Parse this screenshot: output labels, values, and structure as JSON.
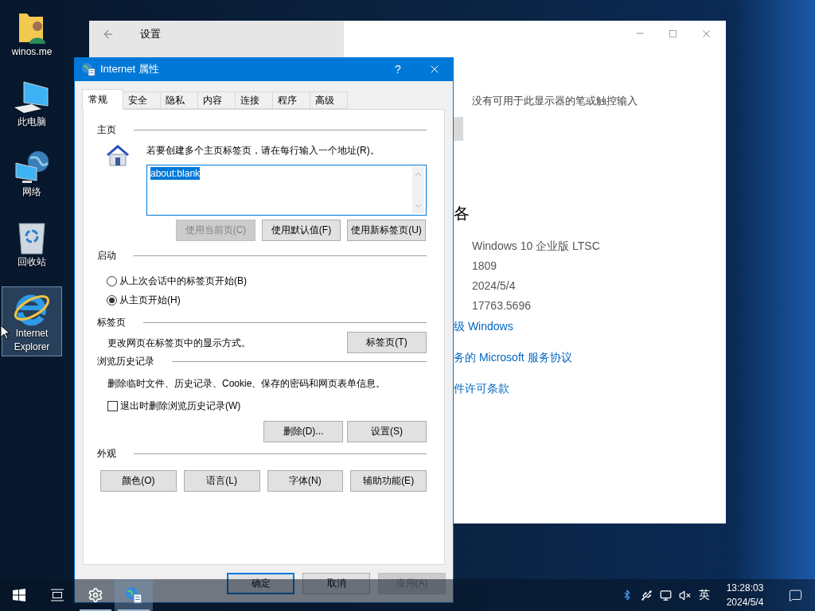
{
  "desktop_icons": [
    {
      "label": "winos.me",
      "kind": "user-folder",
      "selected": false
    },
    {
      "label": "此电脑",
      "kind": "computer",
      "selected": false
    },
    {
      "label": "网络",
      "kind": "network",
      "selected": false
    },
    {
      "label": "回收站",
      "kind": "recycle-bin",
      "selected": false
    },
    {
      "label": "Internet Explorer",
      "kind": "browser",
      "selected": true
    }
  ],
  "settings_window": {
    "title": "设置",
    "pen_notice": "没有可用于此显示器的笔或触控输入",
    "heading": "各",
    "specs": [
      "Windows 10 企业版 LTSC",
      "1809",
      "2024/5/4",
      "17763.5696"
    ],
    "links": [
      "级 Windows",
      "务的 Microsoft 服务协议",
      "件许可条款"
    ]
  },
  "dialog": {
    "title": "Internet 属性",
    "help": "?",
    "tabs": [
      {
        "label": "常规",
        "selected": true
      },
      {
        "label": "安全",
        "selected": false
      },
      {
        "label": "隐私",
        "selected": false
      },
      {
        "label": "内容",
        "selected": false
      },
      {
        "label": "连接",
        "selected": false
      },
      {
        "label": "程序",
        "selected": false
      },
      {
        "label": "高级",
        "selected": false
      }
    ],
    "home": {
      "heading": "主页",
      "hint": "若要创建多个主页标签页，请在每行输入一个地址(R)。",
      "value": "about:blank",
      "buttons": [
        {
          "label": "使用当前页(C)",
          "disabled": true
        },
        {
          "label": "使用默认值(F)",
          "disabled": false
        },
        {
          "label": "使用新标签页(U)",
          "disabled": false
        }
      ]
    },
    "startup": {
      "heading": "启动",
      "options": [
        {
          "label": "从上次会话中的标签页开始(B)",
          "selected": false
        },
        {
          "label": "从主页开始(H)",
          "selected": true
        }
      ]
    },
    "tab_settings": {
      "heading": "标签页",
      "description": "更改网页在标签页中的显示方式。",
      "button": "标签页(T)"
    },
    "history": {
      "heading": "浏览历史记录",
      "description": "删除临时文件、历史记录、Cookie、保存的密码和网页表单信息。",
      "checkbox": {
        "label": "退出时删除浏览历史记录(W)",
        "checked": false
      },
      "buttons": [
        "删除(D)...",
        "设置(S)"
      ]
    },
    "appearance": {
      "heading": "外观",
      "buttons": [
        "颜色(O)",
        "语言(L)",
        "字体(N)",
        "辅助功能(E)"
      ]
    },
    "buttons": [
      {
        "label": "确定",
        "default": true,
        "disabled": false
      },
      {
        "label": "取消",
        "default": false,
        "disabled": false
      },
      {
        "label": "应用(A)",
        "default": false,
        "disabled": true
      }
    ]
  },
  "taskbar": {
    "apps": [
      {
        "kind": "settings",
        "selected": false
      },
      {
        "kind": "internet-options",
        "selected": true
      }
    ],
    "ime": "英",
    "time": "13:28:03",
    "date": "2024/5/4"
  }
}
